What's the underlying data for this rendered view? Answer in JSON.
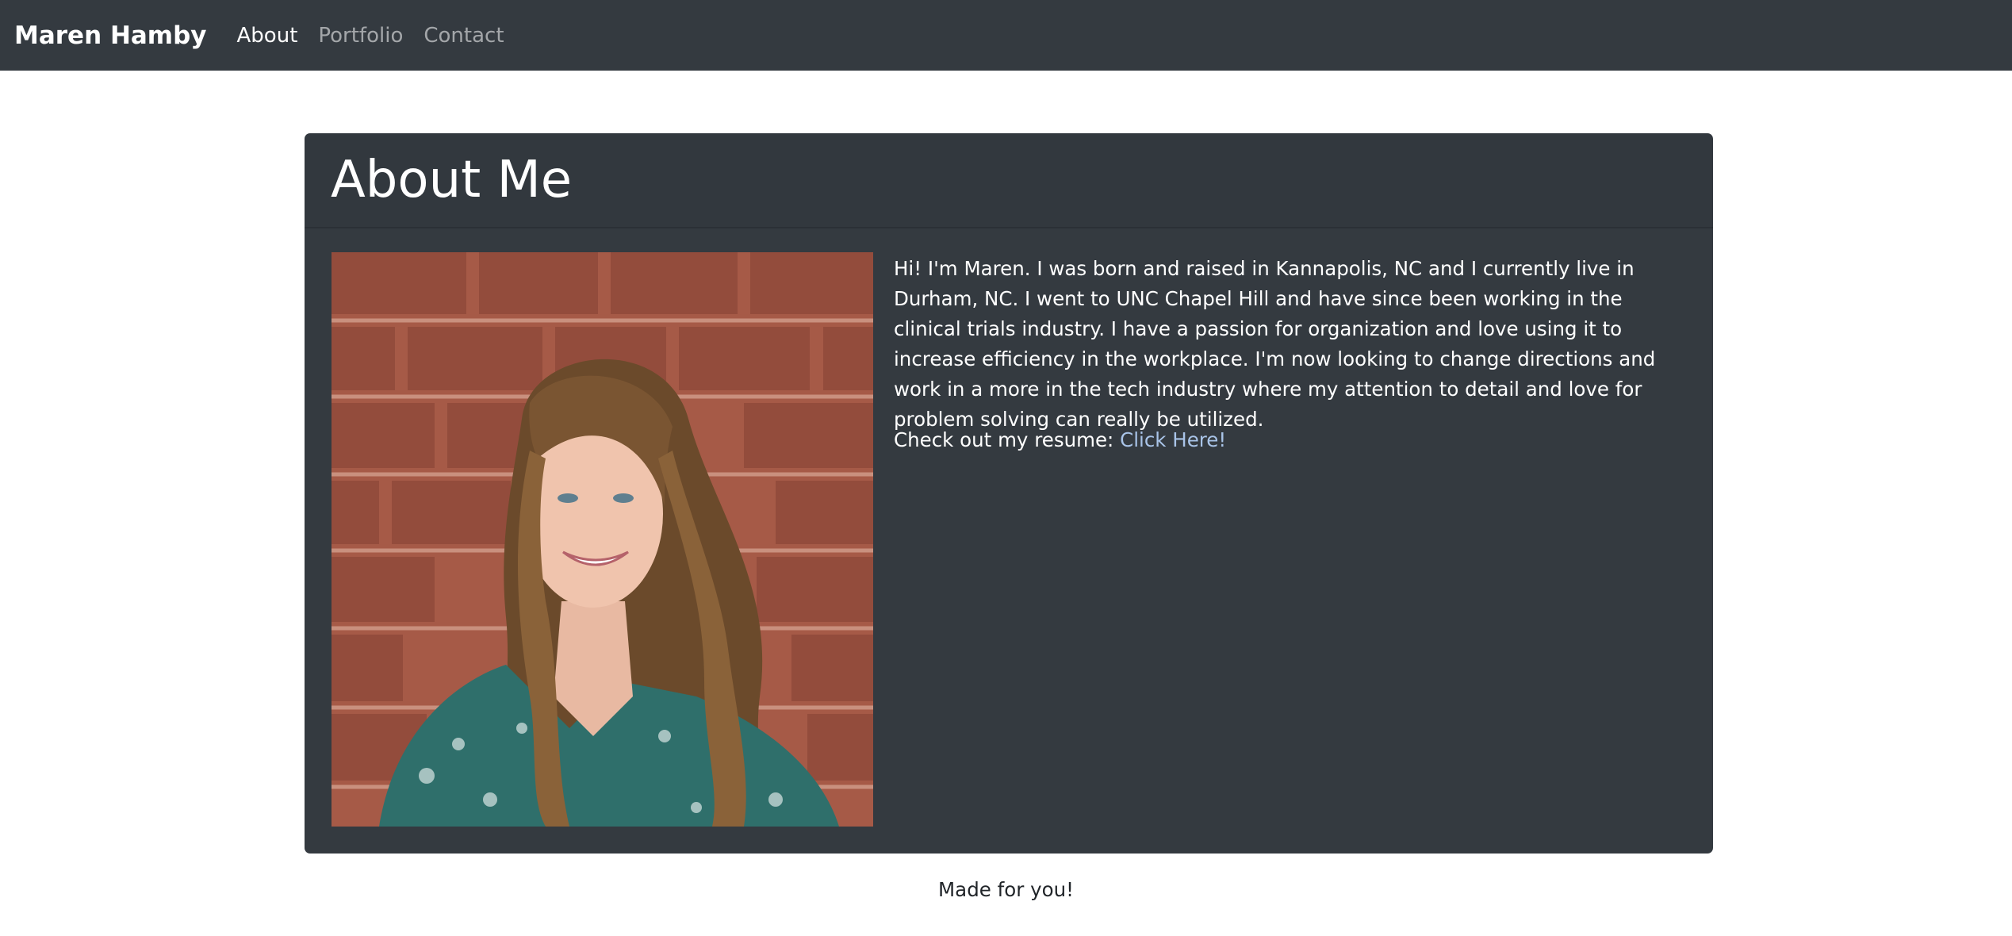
{
  "navbar": {
    "brand": "Maren Hamby",
    "links": [
      {
        "label": "About",
        "active": true
      },
      {
        "label": "Portfolio",
        "active": false
      },
      {
        "label": "Contact",
        "active": false
      }
    ]
  },
  "about": {
    "title": "About Me",
    "bio": "Hi! I'm Maren. I was born and raised in Kannapolis, NC and I currently live in Durham, NC. I went to UNC Chapel Hill and have since been working in the clinical trials industry. I have a passion for organization and love using it to increase efficiency in the workplace. I'm now looking to change directions and work in a more in the tech industry where my attention to detail and love for problem solving can really be utilized.",
    "resume_prefix": "Check out my resume: ",
    "resume_link": "Click Here!"
  },
  "footer": {
    "text": "Made for you!"
  },
  "colors": {
    "navbar_bg": "#343a40",
    "card_bg": "#343a40",
    "link": "#a9c4e8",
    "brick": "#a65a47"
  }
}
